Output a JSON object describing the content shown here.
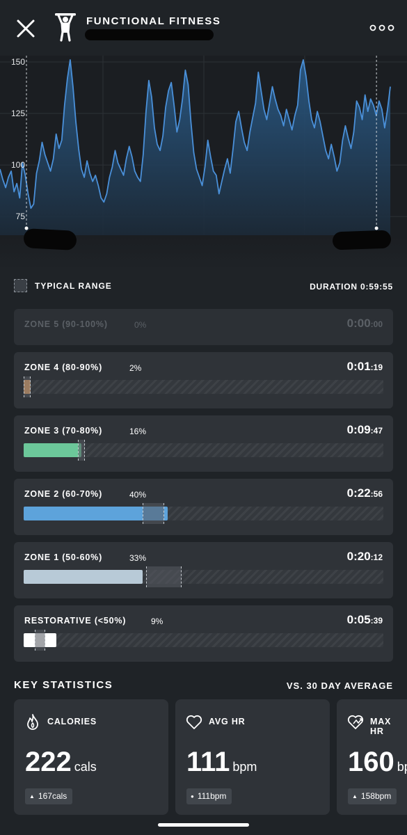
{
  "header": {
    "title": "FUNCTIONAL FITNESS",
    "close_icon": "close-icon",
    "menu_icon": "more-horizontal-icon"
  },
  "chart_data": {
    "type": "line",
    "title": "",
    "xlabel": "",
    "ylabel": "",
    "y_ticks": [
      "150",
      "125",
      "100",
      "75"
    ],
    "ylim": [
      72,
      151
    ],
    "x_index_range": [
      0,
      140
    ],
    "line_color": "#4a90d9",
    "series": [
      {
        "values": [
          98,
          93,
          89,
          94,
          97,
          87,
          91,
          84,
          101,
          95,
          86,
          79,
          81,
          96,
          102,
          111,
          105,
          101,
          97,
          103,
          115,
          108,
          112,
          129,
          142,
          151,
          138,
          121,
          108,
          98,
          94,
          102,
          96,
          92,
          95,
          90,
          84,
          82,
          86,
          94,
          99,
          107,
          101,
          98,
          95,
          103,
          109,
          104,
          97,
          94,
          92,
          105,
          126,
          141,
          133,
          118,
          110,
          107,
          114,
          128,
          136,
          140,
          129,
          116,
          122,
          132,
          146,
          139,
          121,
          106,
          98,
          94,
          90,
          99,
          112,
          104,
          97,
          95,
          86,
          92,
          98,
          103,
          96,
          108,
          121,
          126,
          118,
          111,
          107,
          116,
          123,
          130,
          145,
          136,
          127,
          122,
          130,
          138,
          132,
          127,
          124,
          119,
          127,
          122,
          117,
          124,
          129,
          146,
          151,
          143,
          131,
          122,
          118,
          126,
          121,
          114,
          107,
          103,
          110,
          104,
          97,
          101,
          112,
          119,
          113,
          108,
          116,
          131,
          128,
          122,
          134,
          126,
          132,
          129,
          124,
          131,
          127,
          118,
          127,
          138
        ]
      }
    ],
    "typical_range_markers": [
      0.065,
      0.925
    ],
    "grid": true
  },
  "legend": {
    "label": "TYPICAL RANGE"
  },
  "duration": {
    "text": "DURATION 0:59:55"
  },
  "zones": [
    {
      "label": "ZONE 5 (90-100%)",
      "pct": "0%",
      "time_main": "0:00",
      "time_sec": ":00",
      "fill_fraction": 0.0,
      "typical_range": [
        0.0,
        0.0
      ],
      "color": "#6f747a",
      "dim": true
    },
    {
      "label": "ZONE 4 (80-90%)",
      "pct": "2%",
      "time_main": "0:01",
      "time_sec": ":19",
      "fill_fraction": 0.02,
      "typical_range": [
        0.0,
        0.02
      ],
      "color": "#f0a662",
      "dim": false
    },
    {
      "label": "ZONE 3 (70-80%)",
      "pct": "16%",
      "time_main": "0:09",
      "time_sec": ":47",
      "fill_fraction": 0.16,
      "typical_range": [
        0.15,
        0.17
      ],
      "color": "#6cc79a",
      "dim": false
    },
    {
      "label": "ZONE 2 (60-70%)",
      "pct": "40%",
      "time_main": "0:22",
      "time_sec": ":56",
      "fill_fraction": 0.4,
      "typical_range": [
        0.33,
        0.39
      ],
      "color": "#5da3db",
      "dim": false
    },
    {
      "label": "ZONE 1 (50-60%)",
      "pct": "33%",
      "time_main": "0:20",
      "time_sec": ":12",
      "fill_fraction": 0.33,
      "typical_range": [
        0.34,
        0.44
      ],
      "color": "#b8cad7",
      "dim": false
    },
    {
      "label": "RESTORATIVE (<50%)",
      "pct": "9%",
      "time_main": "0:05",
      "time_sec": ":39",
      "fill_fraction": 0.09,
      "typical_range": [
        0.03,
        0.06
      ],
      "color": "#ffffff",
      "dim": false
    }
  ],
  "key_statistics": {
    "title": "KEY STATISTICS",
    "comparison": "VS. 30 DAY AVERAGE",
    "cards": [
      {
        "label": "CALORIES",
        "icon": "flame-icon",
        "value": "222",
        "unit": "cals",
        "badge": "167cals",
        "badge_mark": "▲"
      },
      {
        "label": "AVG HR",
        "icon": "heart-icon",
        "value": "111",
        "unit": "bpm",
        "badge": "111bpm",
        "badge_mark": "●"
      },
      {
        "label": "MAX HR",
        "icon": "heart-up-icon",
        "value": "160",
        "unit": "bpm",
        "badge": "158bpm",
        "badge_mark": "▲"
      }
    ]
  }
}
